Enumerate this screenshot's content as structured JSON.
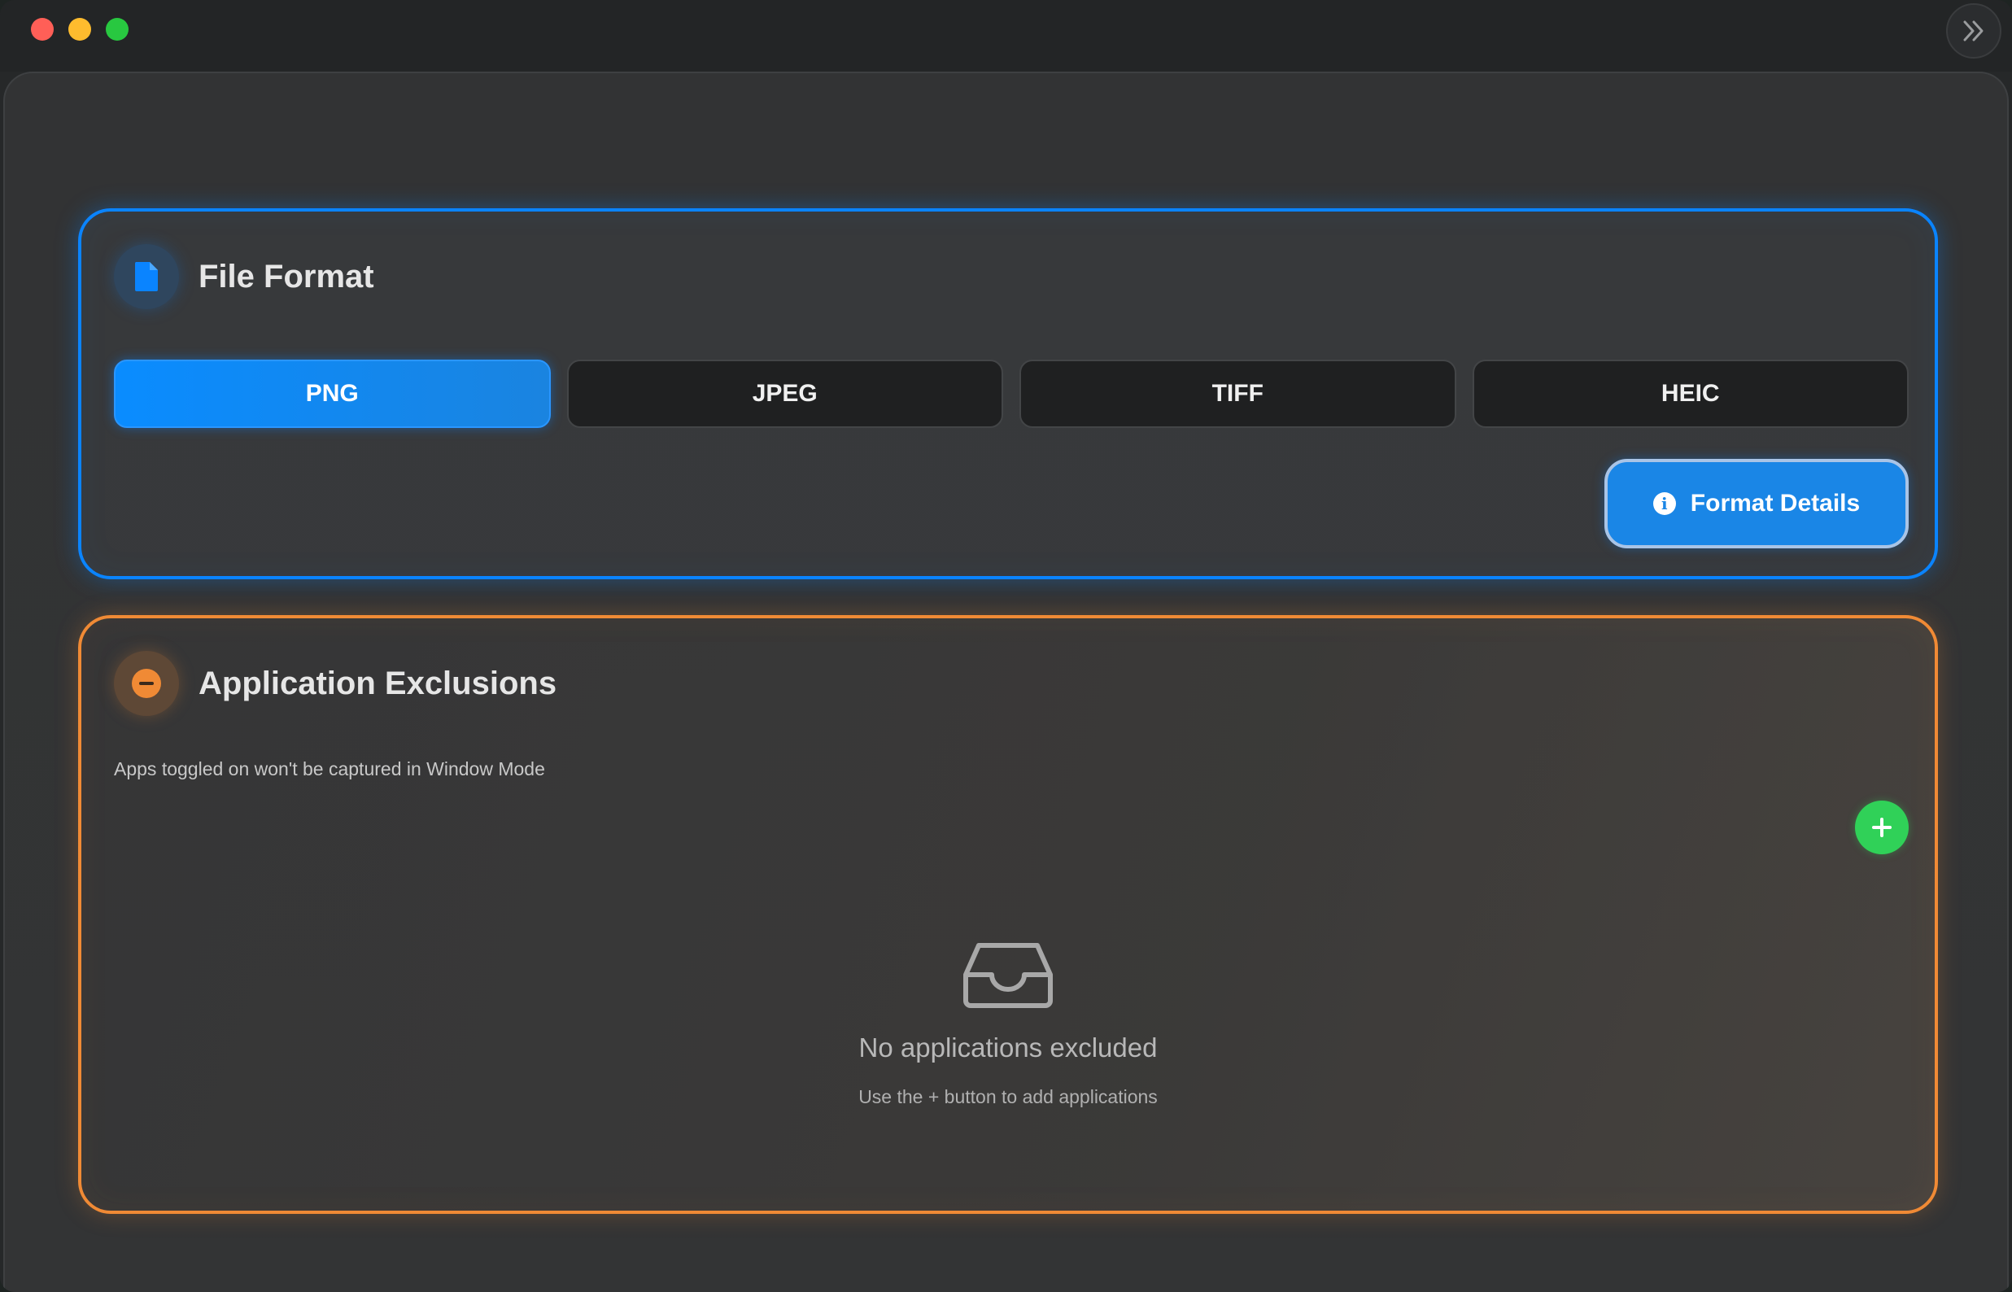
{
  "window": {
    "controls": [
      "close",
      "minimize",
      "maximize"
    ],
    "sidebar_toggle_icon": "chevron-double-right-icon"
  },
  "file_format": {
    "title": "File Format",
    "icon": "document-icon",
    "accent": "#0a84ff",
    "options": [
      {
        "label": "PNG",
        "selected": true
      },
      {
        "label": "JPEG",
        "selected": false
      },
      {
        "label": "TIFF",
        "selected": false
      },
      {
        "label": "HEIC",
        "selected": false
      }
    ],
    "details_button": {
      "label": "Format Details",
      "icon": "info-icon"
    }
  },
  "exclusions": {
    "title": "Application Exclusions",
    "icon": "minus-circle-icon",
    "accent": "#f08a35",
    "subtitle": "Apps toggled on won't be captured in Window Mode",
    "add_button_icon": "plus-icon",
    "add_button_color": "#30d158",
    "empty_state": {
      "icon": "inbox-tray-icon",
      "title": "No applications excluded",
      "hint": "Use the + button to add applications"
    }
  }
}
